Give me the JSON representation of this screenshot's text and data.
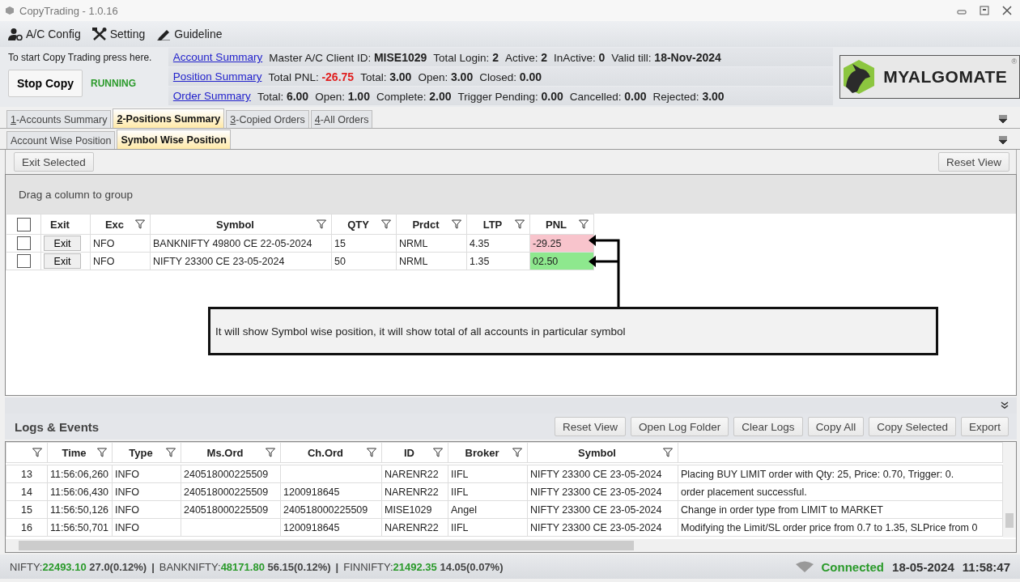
{
  "window": {
    "title": "CopyTrading - 1.0.16"
  },
  "menu": [
    {
      "label": "A/C Config",
      "kind": "user"
    },
    {
      "label": "Setting",
      "kind": "tools"
    },
    {
      "label": "Guideline",
      "kind": "pen"
    }
  ],
  "control": {
    "hint": "To start Copy Trading press here.",
    "button": "Stop Copy",
    "status": "RUNNING"
  },
  "summaries": [
    {
      "link": "Account Summary",
      "fields": [
        {
          "label": "Master A/C Client ID:",
          "value": "MISE1029",
          "color": "#222222"
        },
        {
          "label": "Total Login:",
          "value": "2",
          "color": "#222222"
        },
        {
          "label": "Active:",
          "value": "2",
          "color": "#222222"
        },
        {
          "label": "InActive:",
          "value": "0",
          "color": "#222222"
        },
        {
          "label": "Valid till:",
          "value": "18-Nov-2024",
          "color": "#222222"
        }
      ]
    },
    {
      "link": "Position Summary",
      "fields": [
        {
          "label": "Total PNL:",
          "value": "-26.75",
          "color": "#e02020"
        },
        {
          "label": "Total:",
          "value": "3.00",
          "color": "#222222"
        },
        {
          "label": "Open:",
          "value": "3.00",
          "color": "#222222"
        },
        {
          "label": "Closed:",
          "value": "0.00",
          "color": "#222222"
        }
      ]
    },
    {
      "link": "Order Summary",
      "fields": [
        {
          "label": "Total:",
          "value": "6.00",
          "color": "#222222"
        },
        {
          "label": "Open:",
          "value": "1.00",
          "color": "#222222"
        },
        {
          "label": "Complete:",
          "value": "2.00",
          "color": "#222222"
        },
        {
          "label": "Trigger Pending:",
          "value": "0.00",
          "color": "#222222"
        },
        {
          "label": "Cancelled:",
          "value": "0.00",
          "color": "#222222"
        },
        {
          "label": "Rejected:",
          "value": "3.00",
          "color": "#222222"
        }
      ]
    }
  ],
  "logo": {
    "text": "MYALGOMATE",
    "mark": "®"
  },
  "tabs": [
    {
      "label": "1-Accounts Summary",
      "selected": false
    },
    {
      "label": "2-Positions Summary",
      "selected": true
    },
    {
      "label": "3-Copied Orders",
      "selected": false
    },
    {
      "label": "4-All Orders",
      "selected": false
    }
  ],
  "subtabs": [
    {
      "label": "Account Wise Position",
      "selected": false
    },
    {
      "label": "Symbol Wise Position",
      "selected": true
    }
  ],
  "positions": {
    "exit_selected": "Exit Selected",
    "reset_view": "Reset View",
    "group_hint": "Drag a column to group",
    "columns": [
      {
        "kind": "checkbox",
        "checked": false
      },
      {
        "label": "Exit",
        "filter": false
      },
      {
        "label": "Exc",
        "filter": true
      },
      {
        "label": "Symbol",
        "filter": true
      },
      {
        "label": "QTY",
        "filter": true
      },
      {
        "label": "Prdct",
        "filter": true
      },
      {
        "label": "LTP",
        "filter": true
      },
      {
        "label": "PNL",
        "filter": true
      }
    ],
    "rows": [
      {
        "cells": [
          {
            "kind": "checkbox",
            "checked": false
          },
          {
            "kind": "button",
            "text": "Exit"
          },
          {
            "kind": "text",
            "text": "NFO"
          },
          {
            "kind": "text",
            "text": "BANKNIFTY 49800 CE 22-05-2024"
          },
          {
            "kind": "text",
            "text": "15"
          },
          {
            "kind": "text",
            "text": "NRML"
          },
          {
            "kind": "text",
            "text": "4.35"
          },
          {
            "kind": "pnl",
            "text": "-29.25",
            "color": "#f8c4cc"
          }
        ]
      },
      {
        "cells": [
          {
            "kind": "checkbox",
            "checked": false
          },
          {
            "kind": "button",
            "text": "Exit"
          },
          {
            "kind": "text",
            "text": "NFO"
          },
          {
            "kind": "text",
            "text": "NIFTY 23300 CE 23-05-2024"
          },
          {
            "kind": "text",
            "text": "50"
          },
          {
            "kind": "text",
            "text": "NRML"
          },
          {
            "kind": "text",
            "text": "1.35"
          },
          {
            "kind": "pnl",
            "text": "02.50",
            "color": "#8ee88e"
          }
        ]
      }
    ]
  },
  "annotation": "It will show Symbol wise position, it will show total of all accounts in particular symbol",
  "logs": {
    "title": "Logs & Events",
    "buttons": [
      "Reset View",
      "Open Log Folder",
      "Clear Logs",
      "Copy All",
      "Copy Selected",
      "Export"
    ],
    "columns": [
      {
        "filter": true
      },
      {
        "label": "Time",
        "filter": true
      },
      {
        "label": "Type",
        "filter": true
      },
      {
        "label": "Ms.Ord",
        "filter": true
      },
      {
        "label": "Ch.Ord",
        "filter": true
      },
      {
        "label": "ID",
        "filter": true
      },
      {
        "label": "Broker",
        "filter": true
      },
      {
        "label": "Symbol",
        "filter": true
      },
      {
        "filter": false
      }
    ],
    "rows": [
      [
        "13",
        "11:56:06,260",
        "INFO",
        "240518000225509",
        "",
        "NARENR22",
        "IIFL",
        "NIFTY 23300 CE 23-05-2024",
        "Placing BUY LIMIT order with Qty: 25, Price: 0.70, Trigger: 0."
      ],
      [
        "14",
        "11:56:06,430",
        "INFO",
        "240518000225509",
        "1200918645",
        "NARENR22",
        "IIFL",
        "NIFTY 23300 CE 23-05-2024",
        "order placement successful."
      ],
      [
        "15",
        "11:56:50,126",
        "INFO",
        "240518000225509",
        "240518000225509",
        "MISE1029",
        "Angel",
        "NIFTY 23300 CE 23-05-2024",
        "Change in order type from LIMIT to MARKET"
      ],
      [
        "16",
        "11:56:50,701",
        "INFO",
        "",
        "1200918645",
        "NARENR22",
        "IIFL",
        "NIFTY 23300 CE 23-05-2024",
        "Modifying the Limit/SL order price from 0.7 to 1.35, SLPrice from 0"
      ]
    ]
  },
  "status_bar": {
    "indices": [
      {
        "name": "NIFTY:",
        "value": "22493.10",
        "change": "27.0(0.12%)"
      },
      {
        "name": "BANKNIFTY:",
        "value": "48171.80",
        "change": "56.15(0.12%)"
      },
      {
        "name": "FINNIFTY:",
        "value": "21492.35",
        "change": "14.05(0.07%)"
      }
    ],
    "separator": "|",
    "connection": "Connected",
    "date": "18-05-2024",
    "time": "11:58:47"
  }
}
